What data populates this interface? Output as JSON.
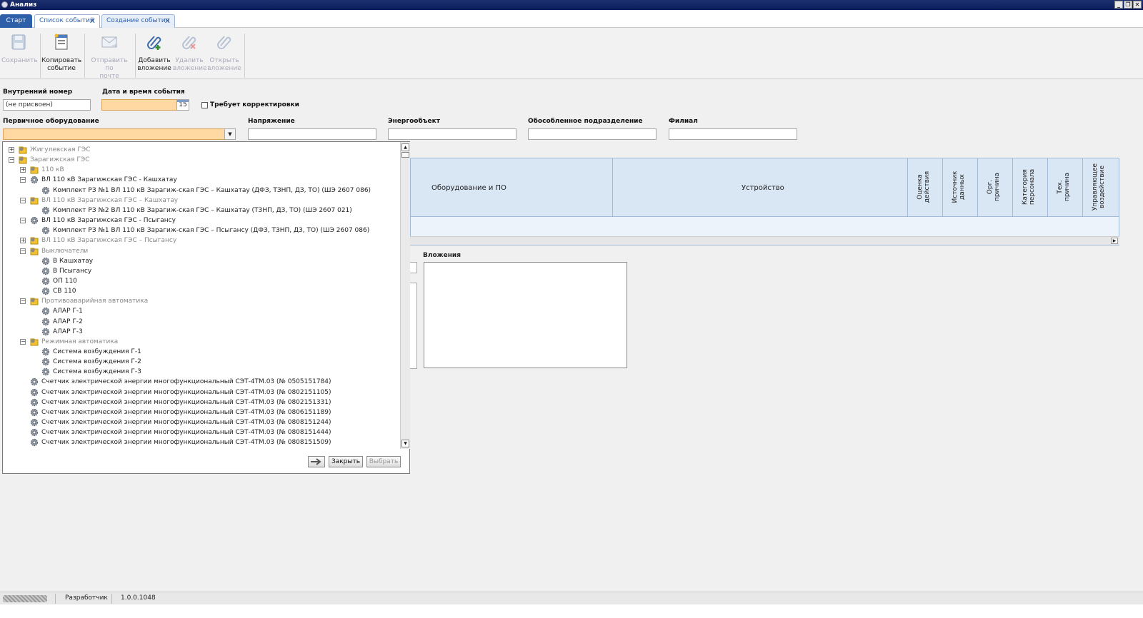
{
  "window": {
    "title": "Анализ",
    "controls": [
      "_",
      "❐",
      "✕"
    ]
  },
  "tabs": {
    "start": "Старт",
    "items": [
      {
        "label": "Список событий",
        "close": "✕"
      },
      {
        "label": "Создание события",
        "close": "✕"
      }
    ]
  },
  "ribbon": {
    "save": "Сохранить",
    "copy_1": "Копировать",
    "copy_2": "событие",
    "mail_1": "Отправить по",
    "mail_2": "почте",
    "add_1": "Добавить",
    "add_2": "вложение",
    "del_1": "Удалить",
    "del_2": "вложение",
    "open_1": "Открыть",
    "open_2": "вложение"
  },
  "form": {
    "internal_number_label": "Внутренний номер",
    "internal_number_value": "(не присвоен)",
    "datetime_label": "Дата и время события",
    "datetime_value": "",
    "calendar_day": "15",
    "needs_correction_label": "Требует корректировки",
    "primary_equipment_label": "Первичное оборудование",
    "primary_equipment_value": "",
    "voltage_label": "Напряжение",
    "energy_object_label": "Энергообъект",
    "subdivision_label": "Обособленное подразделение",
    "branch_label": "Филиал",
    "attachments_label": "Вложения"
  },
  "grid": {
    "col_equipment": "Оборудование и ПО",
    "col_device": "Устройство",
    "col_rating_1": "Оценка",
    "col_rating_2": "действия",
    "col_source_1": "Источник",
    "col_source_2": "данных",
    "col_org_1": "Орг.",
    "col_org_2": "причина",
    "col_staff_1": "Категория",
    "col_staff_2": "персонала",
    "col_tech_1": "Тех.",
    "col_tech_2": "причина",
    "col_control_1": "Управляющее",
    "col_control_2": "воздействие"
  },
  "tree": {
    "nodes": [
      {
        "text": "Жигулевская ГЭС",
        "exp": "+"
      },
      {
        "text": "Зарагижская ГЭС",
        "exp": "−"
      },
      {
        "text": "110 кВ",
        "exp": "+"
      },
      {
        "text": "ВЛ 110 кВ Зарагижская ГЭС - Кашхатау",
        "exp": "−"
      },
      {
        "text": "Комплект РЗ №1 ВЛ 110 кВ Зарагиж-ская ГЭС – Кашхатау (ДФЗ, ТЗНП, ДЗ, ТО) (ШЭ 2607 086)"
      },
      {
        "text": "ВЛ 110 кВ Зарагижская ГЭС – Кашхатау",
        "exp": "−"
      },
      {
        "text": "Комплект РЗ №2 ВЛ 110 кВ Зарагиж-ская ГЭС – Кашхатау (ТЗНП, ДЗ, ТО) (ШЭ 2607 021)"
      },
      {
        "text": "ВЛ 110 кВ Зарагижская ГЭС - Псыгансу",
        "exp": "−"
      },
      {
        "text": "Комплект РЗ №1 ВЛ 110 кВ Зарагиж-ская ГЭС – Псыгансу (ДФЗ, ТЗНП, ДЗ, ТО) (ШЭ 2607 086)"
      },
      {
        "text": "ВЛ 110 кВ Зарагижская ГЭС – Псыгансу",
        "exp": "+"
      },
      {
        "text": "Выключатели",
        "exp": "−"
      },
      {
        "text": "В Кашхатау"
      },
      {
        "text": "В Псыгансу"
      },
      {
        "text": "ОП 110"
      },
      {
        "text": "СВ 110"
      },
      {
        "text": "Противоаварийная автоматика",
        "exp": "−"
      },
      {
        "text": "АЛАР Г-1"
      },
      {
        "text": "АЛАР Г-2"
      },
      {
        "text": "АЛАР Г-3"
      },
      {
        "text": "Режимная автоматика",
        "exp": "−"
      },
      {
        "text": "Система возбуждения Г-1"
      },
      {
        "text": "Система возбуждения Г-2"
      },
      {
        "text": "Система возбуждения Г-3"
      },
      {
        "text": "Счетчик электрической энергии многофункциональный СЭТ-4ТМ.03 (№ 0505151784)"
      },
      {
        "text": "Счетчик электрической энергии многофункциональный СЭТ-4ТМ.03 (№ 0802151105)"
      },
      {
        "text": "Счетчик электрической энергии многофункциональный СЭТ-4ТМ.03 (№ 0802151331)"
      },
      {
        "text": "Счетчик электрической энергии многофункциональный СЭТ-4ТМ.03 (№ 0806151189)"
      },
      {
        "text": "Счетчик электрической энергии многофункциональный СЭТ-4ТМ.03 (№ 0808151244)"
      },
      {
        "text": "Счетчик электрической энергии многофункциональный СЭТ-4ТМ.03 (№ 0808151444)"
      },
      {
        "text": "Счетчик электрической энергии многофункциональный СЭТ-4ТМ.03 (№ 0808151509)"
      }
    ],
    "close_button": "Закрыть",
    "select_button": "Выбрать"
  },
  "status": {
    "role": "Разработчик",
    "version": "1.0.0.1048"
  },
  "colors": {
    "titlebar": "#0b1e5c",
    "accent": "#2f5fa8",
    "required_field": "#ffd9a1",
    "grid_header": "#d9e6f4"
  }
}
